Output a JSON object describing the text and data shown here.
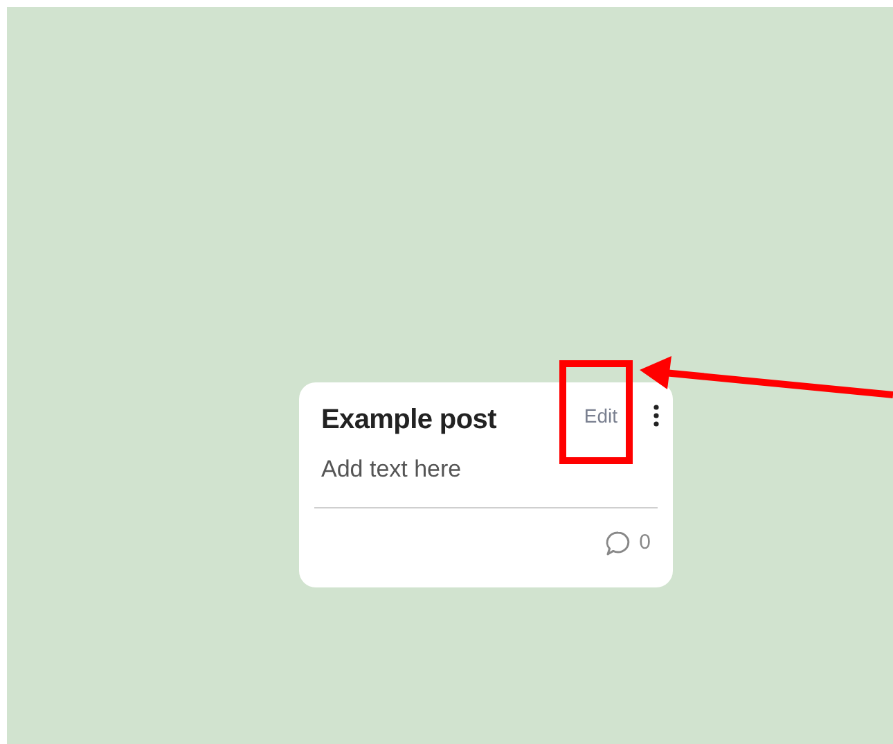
{
  "post": {
    "title": "Example post",
    "edit_label": "Edit",
    "body": "Add text here",
    "comment_count": "0"
  }
}
